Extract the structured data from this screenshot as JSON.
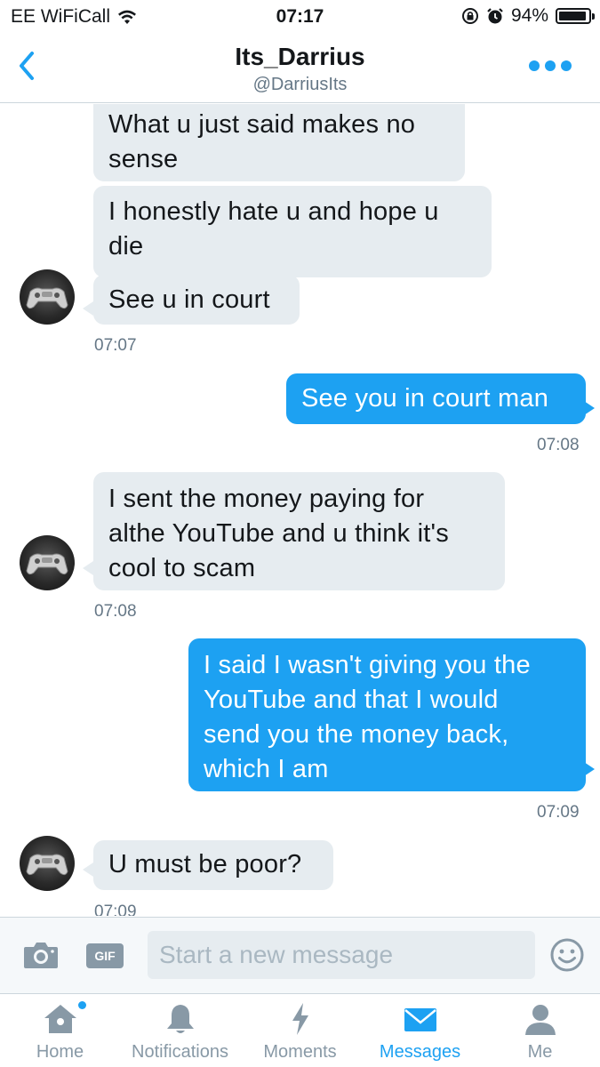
{
  "status_bar": {
    "carrier": "EE WiFiCall",
    "time": "07:17",
    "battery": "94%",
    "battery_level": 0.94,
    "icons": [
      "wifi-icon",
      "rotation-lock-icon",
      "alarm-icon",
      "battery-icon"
    ]
  },
  "header": {
    "title": "Its_Darrius",
    "handle": "@DarriusIts",
    "back_icon": "chevron-left-icon",
    "more_icon": "more-dots-icon"
  },
  "messages": [
    {
      "direction": "incoming",
      "text_lines": [
        "What u just said makes no",
        "sense"
      ]
    },
    {
      "direction": "incoming",
      "text_lines": [
        "I honestly hate u and hope u",
        "die"
      ]
    },
    {
      "direction": "incoming",
      "text_lines": [
        "See u in court"
      ]
    },
    {
      "direction": "outgoing",
      "text_lines": [
        "See you in court man"
      ]
    },
    {
      "direction": "incoming",
      "text_lines": [
        "I sent the money paying for",
        "althe YouTube and u think it's",
        "cool to scam"
      ]
    },
    {
      "direction": "outgoing",
      "text_lines": [
        "I said I wasn't giving you the",
        "YouTube and that I would",
        "send you the money back,",
        "which I am"
      ]
    },
    {
      "direction": "incoming",
      "text_lines": [
        "U must be poor?"
      ]
    }
  ],
  "timestamps": [
    "07:07",
    "07:08",
    "07:08",
    "07:09",
    "07:09"
  ],
  "composer": {
    "placeholder": "Start a new message",
    "value": "",
    "gif_label": "GIF",
    "camera_icon": "camera-icon",
    "emoji_icon": "emoji-icon"
  },
  "tabs": [
    {
      "label": "Home",
      "icon": "home-icon",
      "active": false,
      "has_dot": true
    },
    {
      "label": "Notifications",
      "icon": "bell-icon",
      "active": false
    },
    {
      "label": "Moments",
      "icon": "lightning-icon",
      "active": false
    },
    {
      "label": "Messages",
      "icon": "envelope-icon",
      "active": true
    },
    {
      "label": "Me",
      "icon": "person-icon",
      "active": false
    }
  ],
  "colors": {
    "accent": "#1da1f2",
    "incoming_bubble": "#e6ecf0",
    "muted": "#657786",
    "inactive_tab": "#8899a6"
  }
}
